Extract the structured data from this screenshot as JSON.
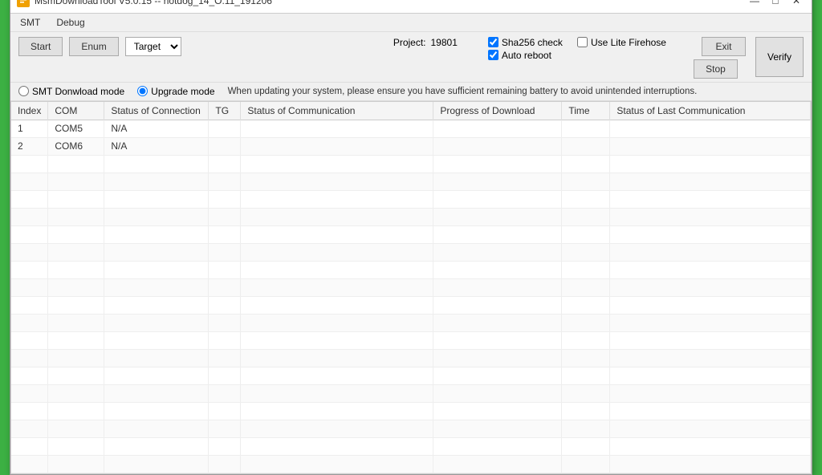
{
  "window": {
    "title": "MsmDownloadTool V5.0.15 -- hotdog_14_O.11_191206",
    "icon": "M"
  },
  "title_controls": {
    "minimize": "—",
    "maximize": "□",
    "close": "✕"
  },
  "menu": {
    "items": [
      "SMT",
      "Debug"
    ]
  },
  "toolbar": {
    "start_label": "Start",
    "enum_label": "Enum",
    "target_label": "Target",
    "target_options": [
      "Target"
    ],
    "project_label": "Project:",
    "project_value": "19801",
    "sha256_label": "Sha256 check",
    "auto_reboot_label": "Auto reboot",
    "lite_firehose_label": "Use Lite Firehose",
    "exit_label": "Exit",
    "stop_label": "Stop",
    "verify_label": "Verify"
  },
  "mode_bar": {
    "smt_label": "SMT Donwload mode",
    "upgrade_label": "Upgrade mode",
    "notice": "When updating your system, please ensure you have sufficient remaining battery to avoid unintended interruptions."
  },
  "table": {
    "headers": [
      "Index",
      "COM",
      "Status of Connection",
      "TG",
      "Status of Communication",
      "Progress of Download",
      "Time",
      "Status of Last Communication"
    ],
    "rows": [
      {
        "index": "1",
        "com": "COM5",
        "status_conn": "N/A",
        "tg": "",
        "status_comm": "",
        "progress": "",
        "time": "",
        "last_comm": ""
      },
      {
        "index": "2",
        "com": "COM6",
        "status_conn": "N/A",
        "tg": "",
        "status_comm": "",
        "progress": "",
        "time": "",
        "last_comm": ""
      }
    ],
    "empty_rows": 18
  }
}
